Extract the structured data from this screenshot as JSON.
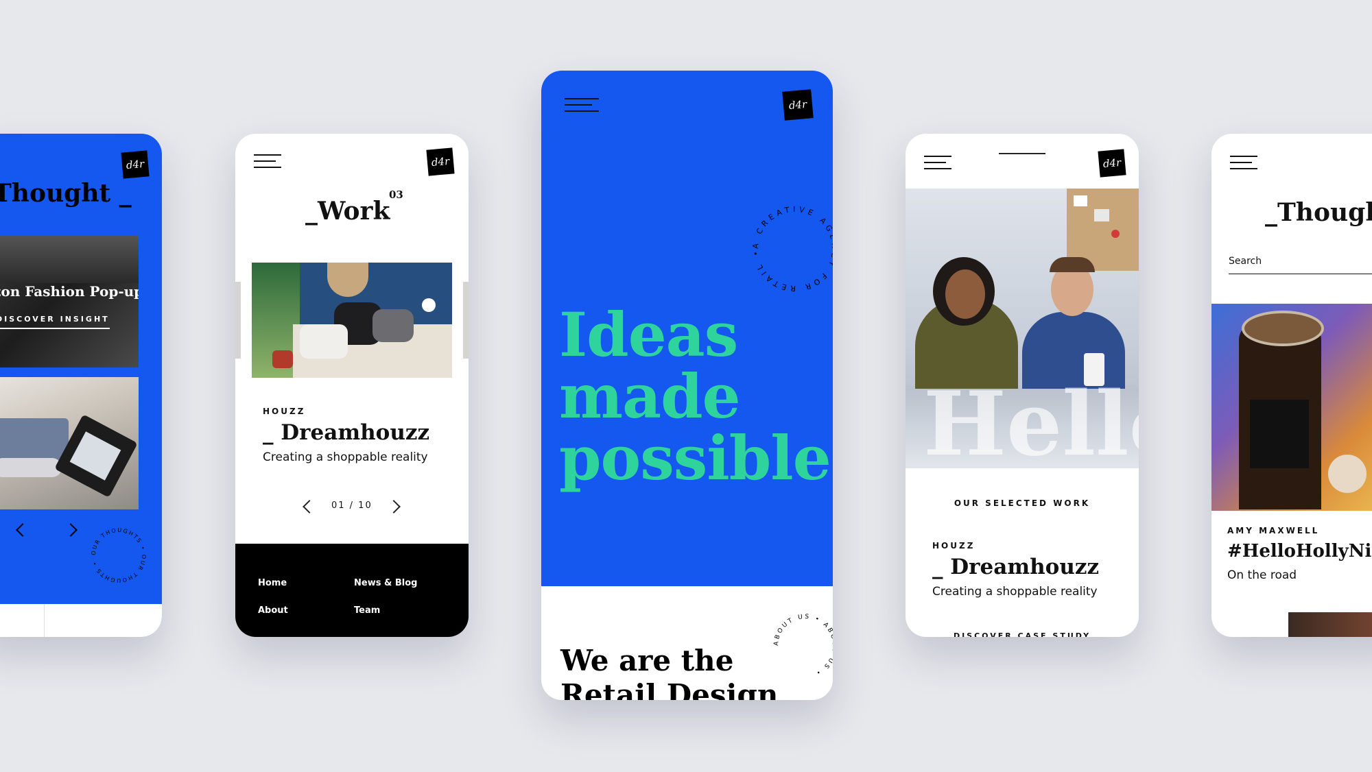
{
  "colors": {
    "blue": "#1458f0",
    "green": "#2fd49c",
    "black": "#000000",
    "white": "#ffffff",
    "bg": "#e7e8ec"
  },
  "brand": {
    "logo_text": "d4r"
  },
  "phone1": {
    "title": "Thought _",
    "card_title": "zon Fashion Pop-up",
    "card_link": "DISCOVER INSIGHT",
    "circle_text": "OUR THOUGHTS • OUR THOUGHTS •"
  },
  "phone2": {
    "title": "_Work",
    "title_sup": "03",
    "client": "HOUZZ",
    "project": "_ Dreamhouzz",
    "tagline": "Creating a shoppable reality",
    "pager": "01 / 10",
    "footer": {
      "home": "Home",
      "news": "News & Blog",
      "about": "About",
      "team": "Team"
    }
  },
  "phone3": {
    "circle_text": "A CREATIVE AGENCY FOR RETAIL •",
    "headline": [
      "Ideas",
      "made",
      "possible."
    ],
    "about_circle": "ABOUT US • ABOUT US •",
    "subhead": [
      "We are the",
      "Retail Design"
    ]
  },
  "phone4": {
    "hello": "Hello",
    "section_label": "OUR SELECTED WORK",
    "client": "HOUZZ",
    "project": "_ Dreamhouzz",
    "tagline": "Creating a shoppable reality",
    "cta": "DISCOVER CASE STUDY"
  },
  "phone5": {
    "title": "_Thought",
    "search_placeholder": "Search",
    "author": "AMY MAXWELL",
    "post_title": "#HelloHollyNich",
    "post_subtitle": "On the road"
  }
}
